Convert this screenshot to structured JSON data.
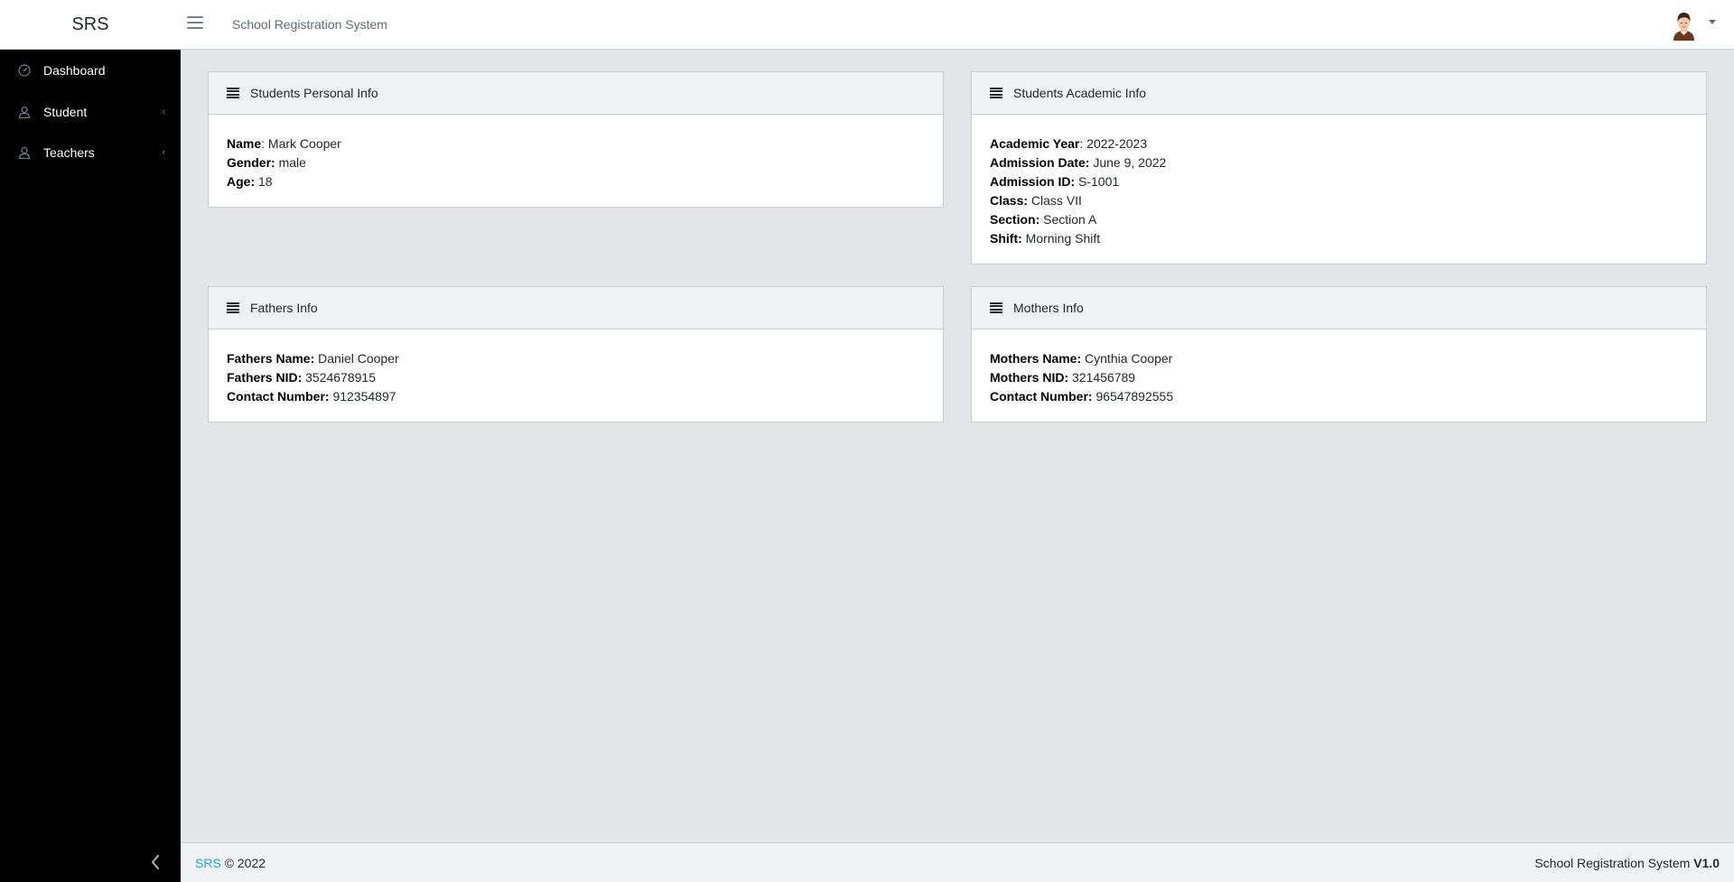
{
  "header": {
    "brand": "SRS",
    "title": "School Registration System"
  },
  "sidebar": {
    "items": [
      {
        "label": "Dashboard",
        "icon": "speedometer-icon"
      },
      {
        "label": "Student",
        "icon": "user-icon"
      },
      {
        "label": "Teachers",
        "icon": "user-icon"
      }
    ]
  },
  "cards": {
    "personal": {
      "title": "Students Personal Info",
      "fields": [
        {
          "label": "Name",
          "value": "Mark Cooper"
        },
        {
          "label": "Gender:",
          "value": "male"
        },
        {
          "label": "Age:",
          "value": "18"
        }
      ]
    },
    "academic": {
      "title": "Students Academic Info",
      "fields": [
        {
          "label": "Academic Year",
          "value": "2022-2023"
        },
        {
          "label": "Admission Date:",
          "value": "June 9, 2022"
        },
        {
          "label": "Admission ID:",
          "value": "S-1001"
        },
        {
          "label": "Class:",
          "value": "Class VII"
        },
        {
          "label": "Section:",
          "value": "Section A"
        },
        {
          "label": "Shift:",
          "value": "Morning Shift"
        }
      ]
    },
    "father": {
      "title": "Fathers Info",
      "fields": [
        {
          "label": "Fathers Name:",
          "value": "Daniel Cooper"
        },
        {
          "label": "Fathers NID:",
          "value": "3524678915"
        },
        {
          "label": "Contact Number:",
          "value": "912354897"
        }
      ]
    },
    "mother": {
      "title": "Mothers Info",
      "fields": [
        {
          "label": "Mothers Name:",
          "value": "Cynthia Cooper"
        },
        {
          "label": "Mothers NID:",
          "value": "321456789"
        },
        {
          "label": "Contact Number:",
          "value": "96547892555"
        }
      ]
    }
  },
  "footer": {
    "brand_link": "SRS",
    "copyright": "© 2022",
    "app_name": "School Registration System",
    "version": "V1.0"
  },
  "colors": {
    "link": "#20a8d8",
    "sidebar_bg": "#000000",
    "page_bg": "#e4e5e6"
  }
}
